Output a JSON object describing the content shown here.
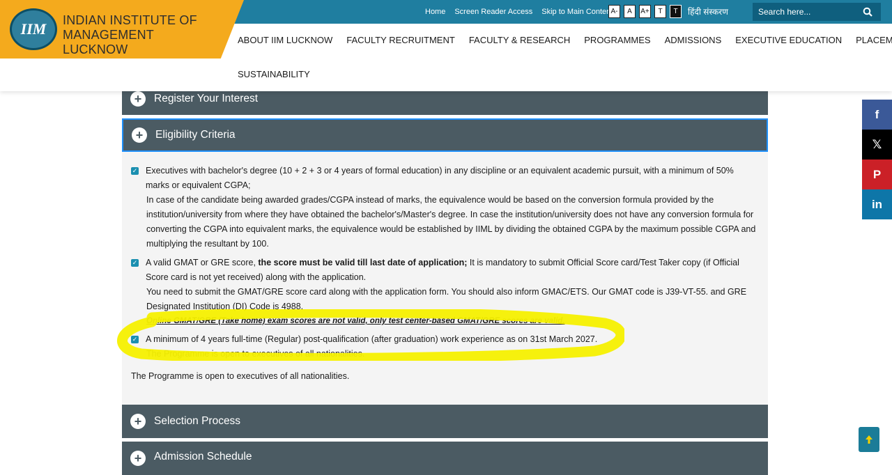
{
  "header": {
    "logo_line1": "INDIAN INSTITUTE OF",
    "logo_line2": "MANAGEMENT LUCKNOW",
    "logo_emblem_text": "IIM",
    "top_links": [
      "Home",
      "Screen Reader Access",
      "Skip to Main Content"
    ],
    "font_buttons": [
      "A-",
      "A",
      "A+",
      "T",
      "T"
    ],
    "hindi_link": "हिंदी संस्करण",
    "search_placeholder": "Search here...",
    "nav_items": [
      "ABOUT IIM LUCKNOW",
      "FACULTY RECRUITMENT",
      "FACULTY & RESEARCH",
      "PROGRAMMES",
      "ADMISSIONS",
      "EXECUTIVE EDUCATION",
      "PLACEMENTS"
    ],
    "nav_row2": "SUSTAINABILITY"
  },
  "accordion": {
    "register": "Register Your Interest",
    "eligibility": "Eligibility Criteria",
    "selection": "Selection Process",
    "schedule": "Admission Schedule"
  },
  "eligibility": {
    "item1_line": "Executives with bachelor's degree (10 + 2 + 3 or 4 years of formal education) in any discipline or an equivalent academic pursuit, with a minimum of 50% marks or equivalent CGPA;",
    "item1_sub": "In case of the candidate being awarded grades/CGPA instead of marks, the equivalence would be based on the conversion formula provided by the institution/university from where they have obtained the bachelor's/Master's degree. In case the institution/university does not have any conversion formula for converting the CGPA into equivalent marks, the equivalence would be established by IIML by dividing the obtained CGPA by the maximum possible CGPA and multiplying the resultant by 100.",
    "item2_pre": "A valid GMAT or GRE score, ",
    "item2_bold": "the score must be valid till last date of application;",
    "item2_post": " It is mandatory to submit Official Score card/Test Taker copy (if Official Score card is not yet received) along with the application.",
    "item2_sub": "You need to submit the GMAT/GRE score card along with the application form. You should also inform GMAC/ETS. Our GMAT code is J39-VT-55. and GRE Designated Institution (DI) Code is 4988.",
    "item2_note": "Online GMAT/GRE (Take home) exam scores are not valid, only test center-based GMAT/GRE scores are valid.",
    "item3": "A minimum of 4 years full-time (Regular) post-qualification (after graduation) work experience as on 31st March 2027.",
    "item3_partial": "The Programme is open to executives of all nationalities.",
    "nationality": "The Programme is open to executives of all nationalities."
  },
  "share": {
    "facebook": "f",
    "x": "𝕏",
    "pinterest": "P",
    "linkedin": "in"
  },
  "colors": {
    "topbar": "#1f7ea0",
    "logo_bg": "#f4aa1d",
    "accordion": "#4b5b63",
    "highlight": "#f5f000"
  }
}
